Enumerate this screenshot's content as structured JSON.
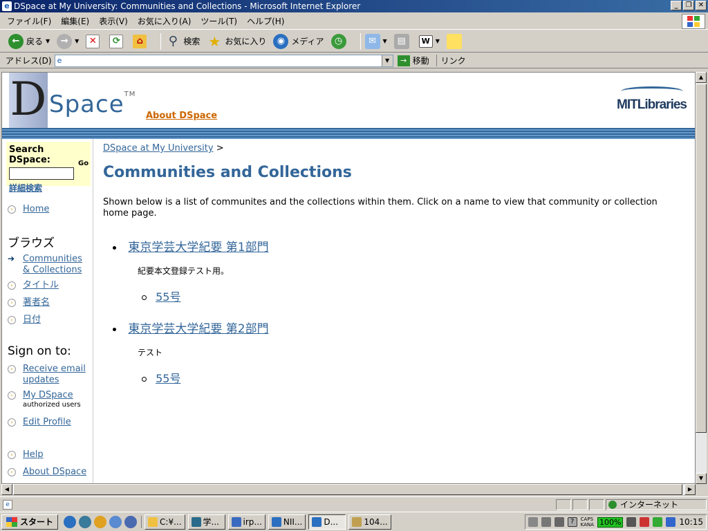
{
  "window": {
    "title": "DSpace at My University: Communities and Collections - Microsoft Internet Explorer"
  },
  "menu": [
    "ファイル(F)",
    "編集(E)",
    "表示(V)",
    "お気に入り(A)",
    "ツール(T)",
    "ヘルプ(H)"
  ],
  "toolbar": {
    "back": "戻る",
    "search": "検索",
    "favorites": "お気に入り",
    "media": "メディア"
  },
  "address": {
    "label": "アドレス(D)",
    "value": "",
    "go": "移動",
    "links": "リンク"
  },
  "banner": {
    "logo_d": "D",
    "logo_space": "Space",
    "tm": "TM",
    "about": "About DSpace",
    "mit": "MITLibraries"
  },
  "sidebar": {
    "search_title": "Search DSpace:",
    "go": "Go",
    "advanced": "詳細検索",
    "home": "Home",
    "browse_heading": "ブラウズ",
    "browse": [
      "Communities & Collections",
      "タイトル",
      "著者名",
      "日付"
    ],
    "signon_heading": "Sign on to:",
    "receive": "Receive email updates",
    "mydspace": "My DSpace",
    "mydspace_sub": "authorized users",
    "edit_profile": "Edit Profile",
    "help": "Help",
    "about": "About DSpace"
  },
  "main": {
    "breadcrumb": "DSpace at My University",
    "breadcrumb_sep": ">",
    "title": "Communities and Collections",
    "intro": "Shown below is a list of communites and the collections within them. Click on a name to view that community or collection home page.",
    "communities": [
      {
        "name": "東京学芸大学紀要 第1部門",
        "desc": "紀要本文登録テスト用。",
        "collections": [
          "55号"
        ]
      },
      {
        "name": "東京学芸大学紀要 第2部門",
        "desc": "テスト",
        "collections": [
          "55号"
        ]
      }
    ]
  },
  "status": {
    "zone": "インターネット"
  },
  "taskbar": {
    "start": "スタート",
    "tasks": [
      "C:¥...",
      "学...",
      "irp...",
      "NII...",
      "D...",
      "104..."
    ],
    "battery": "100%",
    "caps": "CAPS",
    "kana": "KANA",
    "clock": "10:15"
  }
}
